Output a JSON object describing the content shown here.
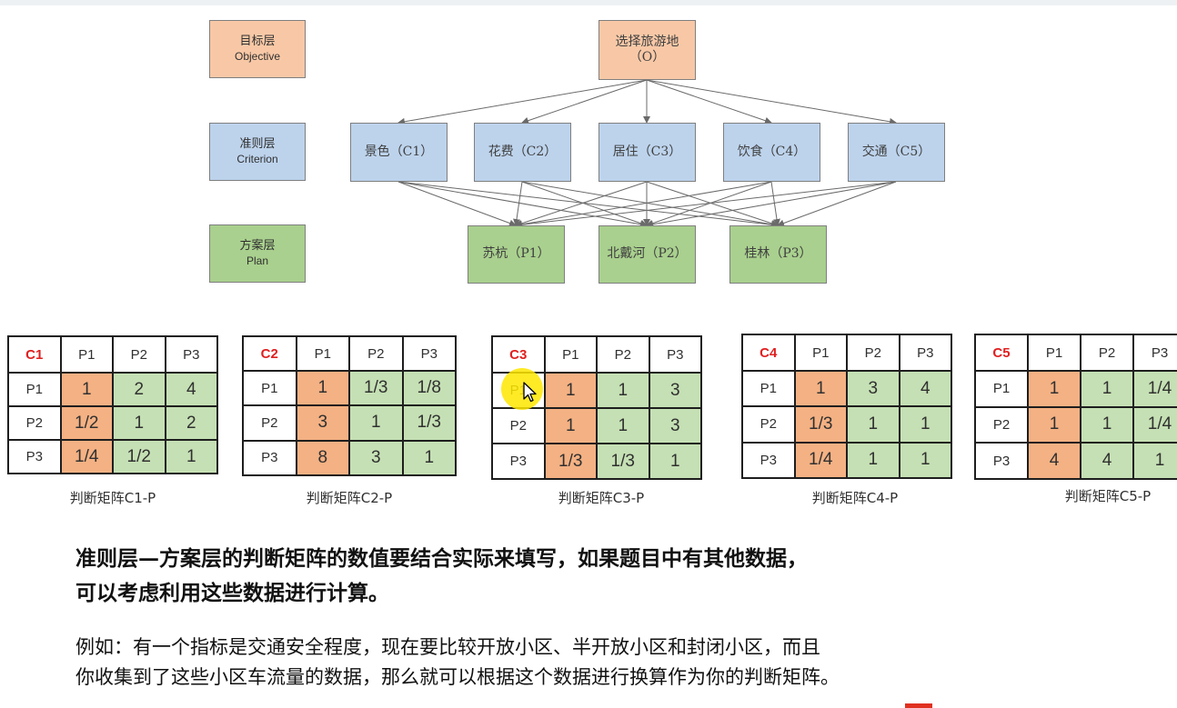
{
  "levels": [
    {
      "cn": "目标层",
      "en": "Objective"
    },
    {
      "cn": "准则层",
      "en": "Criterion"
    },
    {
      "cn": "方案层",
      "en": "Plan"
    }
  ],
  "goal": {
    "line1": "选择旅游地",
    "line2": "（O）"
  },
  "criteria": [
    "景色（C1）",
    "花费（C2）",
    "居住（C3）",
    "饮食（C4）",
    "交通（C5）"
  ],
  "plans": [
    "苏杭（P1）",
    "北戴河（P2）",
    "桂林（P3）"
  ],
  "matrices": [
    {
      "corner": "C1",
      "cols": [
        "P1",
        "P2",
        "P3"
      ],
      "rows": [
        {
          "label": "P1",
          "cells": [
            "1",
            "2",
            "4"
          ]
        },
        {
          "label": "P2",
          "cells": [
            "1/2",
            "1",
            "2"
          ]
        },
        {
          "label": "P3",
          "cells": [
            "1/4",
            "1/2",
            "1"
          ]
        }
      ],
      "caption": "判断矩阵C1-P"
    },
    {
      "corner": "C2",
      "cols": [
        "P1",
        "P2",
        "P3"
      ],
      "rows": [
        {
          "label": "P1",
          "cells": [
            "1",
            "1/3",
            "1/8"
          ]
        },
        {
          "label": "P2",
          "cells": [
            "3",
            "1",
            "1/3"
          ]
        },
        {
          "label": "P3",
          "cells": [
            "8",
            "3",
            "1"
          ]
        }
      ],
      "caption": "判断矩阵C2-P"
    },
    {
      "corner": "C3",
      "cols": [
        "P1",
        "P2",
        "P3"
      ],
      "rows": [
        {
          "label": "P1",
          "cells": [
            "1",
            "1",
            "3"
          ]
        },
        {
          "label": "P2",
          "cells": [
            "1",
            "1",
            "3"
          ]
        },
        {
          "label": "P3",
          "cells": [
            "1/3",
            "1/3",
            "1"
          ]
        }
      ],
      "caption": "判断矩阵C3-P"
    },
    {
      "corner": "C4",
      "cols": [
        "P1",
        "P2",
        "P3"
      ],
      "rows": [
        {
          "label": "P1",
          "cells": [
            "1",
            "3",
            "4"
          ]
        },
        {
          "label": "P2",
          "cells": [
            "1/3",
            "1",
            "1"
          ]
        },
        {
          "label": "P3",
          "cells": [
            "1/4",
            "1",
            "1"
          ]
        }
      ],
      "caption": "判断矩阵C4-P"
    },
    {
      "corner": "C5",
      "cols": [
        "P1",
        "P2",
        "P3"
      ],
      "rows": [
        {
          "label": "P1",
          "cells": [
            "1",
            "1",
            "1/4"
          ]
        },
        {
          "label": "P2",
          "cells": [
            "1",
            "1",
            "1/4"
          ]
        },
        {
          "label": "P3",
          "cells": [
            "4",
            "4",
            "1"
          ]
        }
      ],
      "caption": "判断矩阵C5-P"
    }
  ],
  "paragraph1": {
    "line1": "准则层—方案层的判断矩阵的数值要结合实际来填写，如果题目中有其他数据，",
    "line2": "可以考虑利用这些数据进行计算。"
  },
  "paragraph2": {
    "line1": "例如：有一个指标是交通安全程度，现在要比较开放小区、半开放小区和封闭小区，而且",
    "line2": "你收集到了这些小区车流量的数据，那么就可以根据这个数据进行换算作为你的判断矩阵。"
  }
}
